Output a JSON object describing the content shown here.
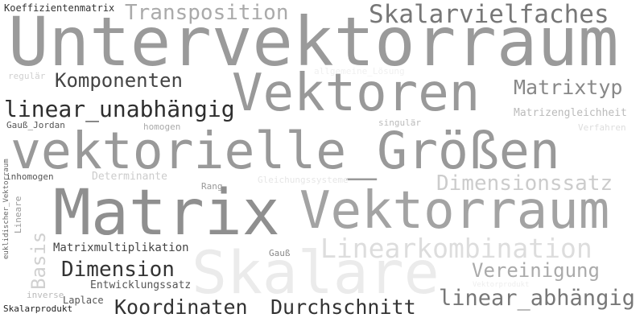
{
  "words": {
    "koeffizientenmatrix": {
      "text": "Koeffizientenmatrix",
      "color": "#333333"
    },
    "transposition": {
      "text": "Transposition",
      "color": "#aaaaaa"
    },
    "skalarvielfaches": {
      "text": "Skalarvielfaches",
      "color": "#777777"
    },
    "untervektorraum": {
      "text": "Untervektorraum",
      "color": "#9a9a9a"
    },
    "regulaer": {
      "text": "regulär",
      "color": "#d0d0d0"
    },
    "allgemeine_loesung": {
      "text": "allgemeine_Lösung",
      "color": "#f0f0f0"
    },
    "komponenten": {
      "text": "Komponenten",
      "color": "#444444"
    },
    "vektoren": {
      "text": "Vektoren",
      "color": "#999999"
    },
    "matrixtyp": {
      "text": "Matrixtyp",
      "color": "#888888"
    },
    "linear_unabhaengig": {
      "text": "linear_unabhängig",
      "color": "#2e2e2e"
    },
    "matrizengleichheit": {
      "text": "Matrizengleichheit",
      "color": "#bbbbbb"
    },
    "gauss_jordan": {
      "text": "Gauß_Jordan",
      "color": "#555555"
    },
    "homogen": {
      "text": "homogen",
      "color": "#aaaaaa"
    },
    "singulaer": {
      "text": "singulär",
      "color": "#bbbbbb"
    },
    "verfahren": {
      "text": "Verfahren",
      "color": "#dddddd"
    },
    "vektorielle_groessen": {
      "text": "vektorielle_Größen",
      "color": "#999999"
    },
    "inhomogen": {
      "text": "inhomogen",
      "color": "#555555"
    },
    "determinante": {
      "text": "Determinante",
      "color": "#cccccc"
    },
    "gleichungssysteme": {
      "text": "Gleichungssysteme",
      "color": "#e6e6e6"
    },
    "dimensionssatz": {
      "text": "Dimensionssatz",
      "color": "#cccccc"
    },
    "rang": {
      "text": "Rang",
      "color": "#999999"
    },
    "euklidischer_vektorraum": {
      "text": "euklidischer_Vektorraum",
      "color": "#666666"
    },
    "lineare": {
      "text": "Lineare",
      "color": "#999999"
    },
    "matrix": {
      "text": "Matrix",
      "color": "#8f8f8f"
    },
    "vektorraum": {
      "text": "Vektorraum",
      "color": "#a3a3a3"
    },
    "basis": {
      "text": "Basis",
      "color": "#d0d0d0"
    },
    "linearkombination": {
      "text": "Linearkombination",
      "color": "#dddddd"
    },
    "matrixmultiplikation": {
      "text": "Matrixmultiplikation",
      "color": "#444444"
    },
    "gauss": {
      "text": "Gauß",
      "color": "#888888"
    },
    "skalare": {
      "text": "Skalare",
      "color": "#ebebeb"
    },
    "dimension": {
      "text": "Dimension",
      "color": "#333333"
    },
    "vereinigung": {
      "text": "Vereinigung",
      "color": "#aaaaaa"
    },
    "entwicklungssatz": {
      "text": "Entwicklungssatz",
      "color": "#555555"
    },
    "vektorprodukt": {
      "text": "Vektorprodukt",
      "color": "#eeeeee"
    },
    "inverse": {
      "text": "inverse",
      "color": "#bbbbbb"
    },
    "laplace": {
      "text": "Laplace",
      "color": "#555555"
    },
    "koordinaten": {
      "text": "Koordinaten",
      "color": "#333333"
    },
    "durchschnitt": {
      "text": "Durchschnitt",
      "color": "#333333"
    },
    "linear_abhaengig": {
      "text": "linear_abhängig",
      "color": "#777777"
    },
    "skalarprodukt": {
      "text": "Skalarprodukt",
      "color": "#222222"
    }
  }
}
